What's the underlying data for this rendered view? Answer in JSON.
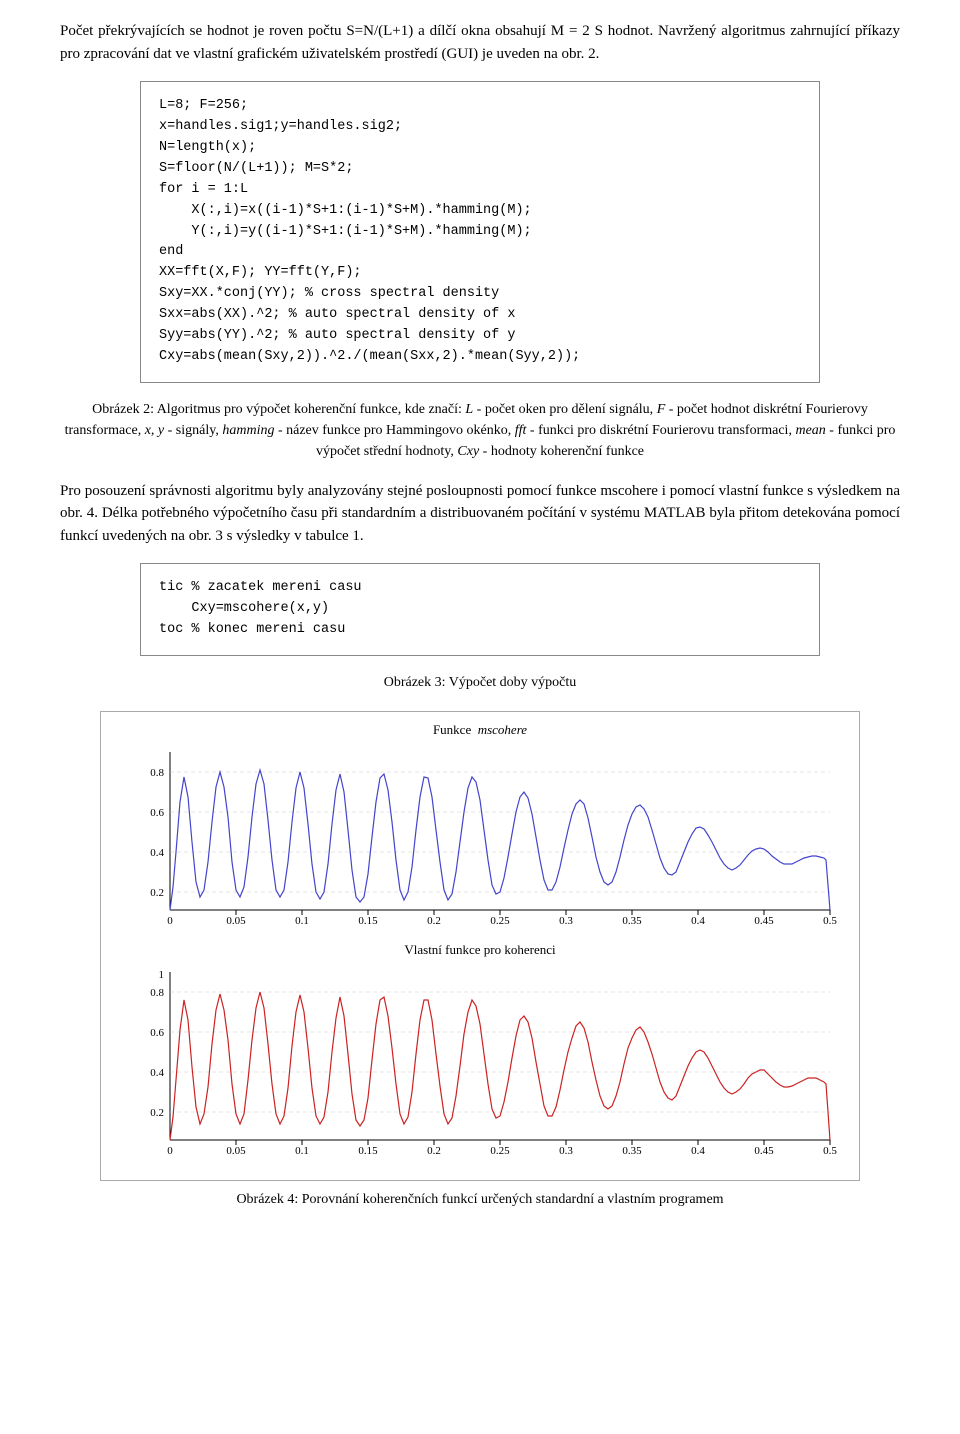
{
  "paragraphs": {
    "p1": "Počet překrývajících se hodnot je roven počtu S=N/(L+1) a dílčí okna obsahují M = 2 S hodnot. Navržený algoritmus zahrnující příkazy pro zpracování dat ve vlastní grafickém uživatelském prostředí (GUI) je uveden na obr. 2.",
    "p2_part1": "Obrázek 2: Algoritmus pro výpočet koherenční funkce, kde značí: ",
    "p2_L": "L",
    "p2_part2": " - počet oken pro dělení signálu, ",
    "p2_F": "F",
    "p2_part3": " - počet hodnot diskrétní Fourierovy transformace, ",
    "p2_xy": "x, y",
    "p2_part4": " - signály, ",
    "p2_hamming": "hamming",
    "p2_part5": " - název funkce pro Hammingovo okénko, ",
    "p2_fft": "fft",
    "p2_part6": " - funkci pro diskrétní Fourierovu transformaci, ",
    "p2_mean": "mean",
    "p2_part7": " - funkci pro výpočet střední hodnoty, ",
    "p2_Cxy": "Cxy",
    "p2_part8": " - hodnoty koherenční funkce",
    "p3": "Pro posouzení správnosti algoritmu byly analyzovány stejné posloupnosti pomocí funkce mscohere i pomocí vlastní funkce s výsledkem na obr. 4. Délka potřebného výpočetního času při standardním a distribuovaném počítání v systému MATLAB byla přitom detekována pomocí funkcí uvedených na obr. 3 s výsledky v tabulce 1.",
    "fig3_caption": "Obrázek 3: Výpočet doby výpočtu",
    "fig4_caption": "Obrázek 4: Porovnání koherenčních funkcí určených standardní a vlastním programem"
  },
  "code_block1": "L=8; F=256;\nx=handles.sig1;y=handles.sig2;\nN=length(x);\nS=floor(N/(L+1)); M=S*2;\nfor i = 1:L\n    X(:,i)=x((i-1)*S+1:(i-1)*S+M).*hamming(M);\n    Y(:,i)=y((i-1)*S+1:(i-1)*S+M).*hamming(M);\nend\nXX=fft(X,F); YY=fft(Y,F);\nSxy=XX.*conj(YY); % cross spectral density\nSxx=abs(XX).^2; % auto spectral density of x\nSyy=abs(YY).^2; % auto spectral density of y\nCxy=abs(mean(Sxy,2)).^2./(mean(Sxx,2).*mean(Syy,2));",
  "code_block2": "tic % zacatek mereni casu\n    Cxy=mscohere(x,y)\ntoc % konec mereni casu",
  "chart1": {
    "title": "Funkce  mscohere",
    "title_italic": "mscohere",
    "y_labels": [
      "0.8",
      "0.6",
      "0.4",
      "0.2"
    ],
    "x_labels": [
      "0",
      "0.05",
      "0.1",
      "0.15",
      "0.2",
      "0.25",
      "0.3",
      "0.35",
      "0.4",
      "0.45",
      "0.5"
    ]
  },
  "chart2": {
    "title": "Vlastní funkce pro koherenci",
    "y_labels": [
      "1",
      "0.8",
      "0.6",
      "0.4",
      "0.2"
    ],
    "x_labels": [
      "0",
      "0.05",
      "0.1",
      "0.15",
      "0.2",
      "0.25",
      "0.3",
      "0.35",
      "0.4",
      "0.45",
      "0.5"
    ]
  }
}
